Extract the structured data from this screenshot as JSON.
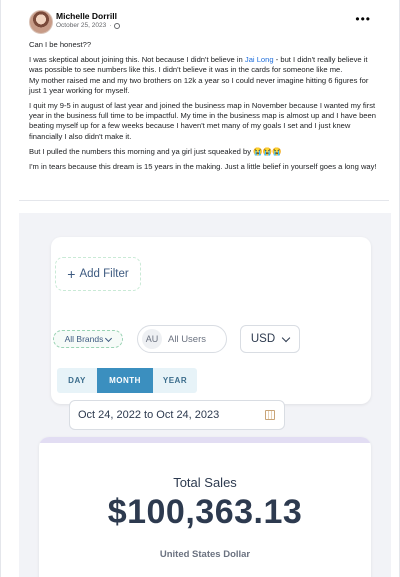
{
  "post": {
    "author": "Michelle Dorrill",
    "date": "October 25, 2023",
    "more_icon": "ellipsis-icon",
    "privacy_icon": "globe-icon",
    "p1": "Can I be honest??",
    "p2_before": "I was skeptical about joining this. Not because I didn't believe in ",
    "p2_mention": "Jai Long",
    "p2_after": " - but I didn't really believe it was possible to see numbers like this. I didn't believe it was in the cards for someone like me.",
    "p3": "My mother raised me and my two brothers on 12k a year so I could never imagine hitting 6 figures for just 1 year working for myself.",
    "p4": "I quit my 9-5 in august of last year and joined the business map in November because I wanted my first year in the business full time to be impactful. My time in the business map is almost up and I have been beating myself up for a few weeks because I haven't met many of my goals I set and I just knew financially I also didn't make it.",
    "p5": "But I pulled the numbers this morning and ya girl just squeaked by 😭😭😭",
    "p6": "I'm in tears because this dream is 15 years in the making. Just a little belief in yourself goes a long way!"
  },
  "dashboard": {
    "add_filter": "Add Filter",
    "brands_filter": "All Brands",
    "users_avatar": "AU",
    "users_filter": "All Users",
    "currency": "USD",
    "periods": [
      "DAY",
      "MONTH",
      "YEAR"
    ],
    "active_period": "MONTH",
    "date_range": "Oct 24, 2022 to Oct 24, 2023",
    "calendar_icon": "calendar-icon",
    "total_sales_title": "Total Sales",
    "total_sales_value": "$100,363.13",
    "total_sales_unit": "United States Dollar",
    "accent_color": "#3b8fbf"
  }
}
